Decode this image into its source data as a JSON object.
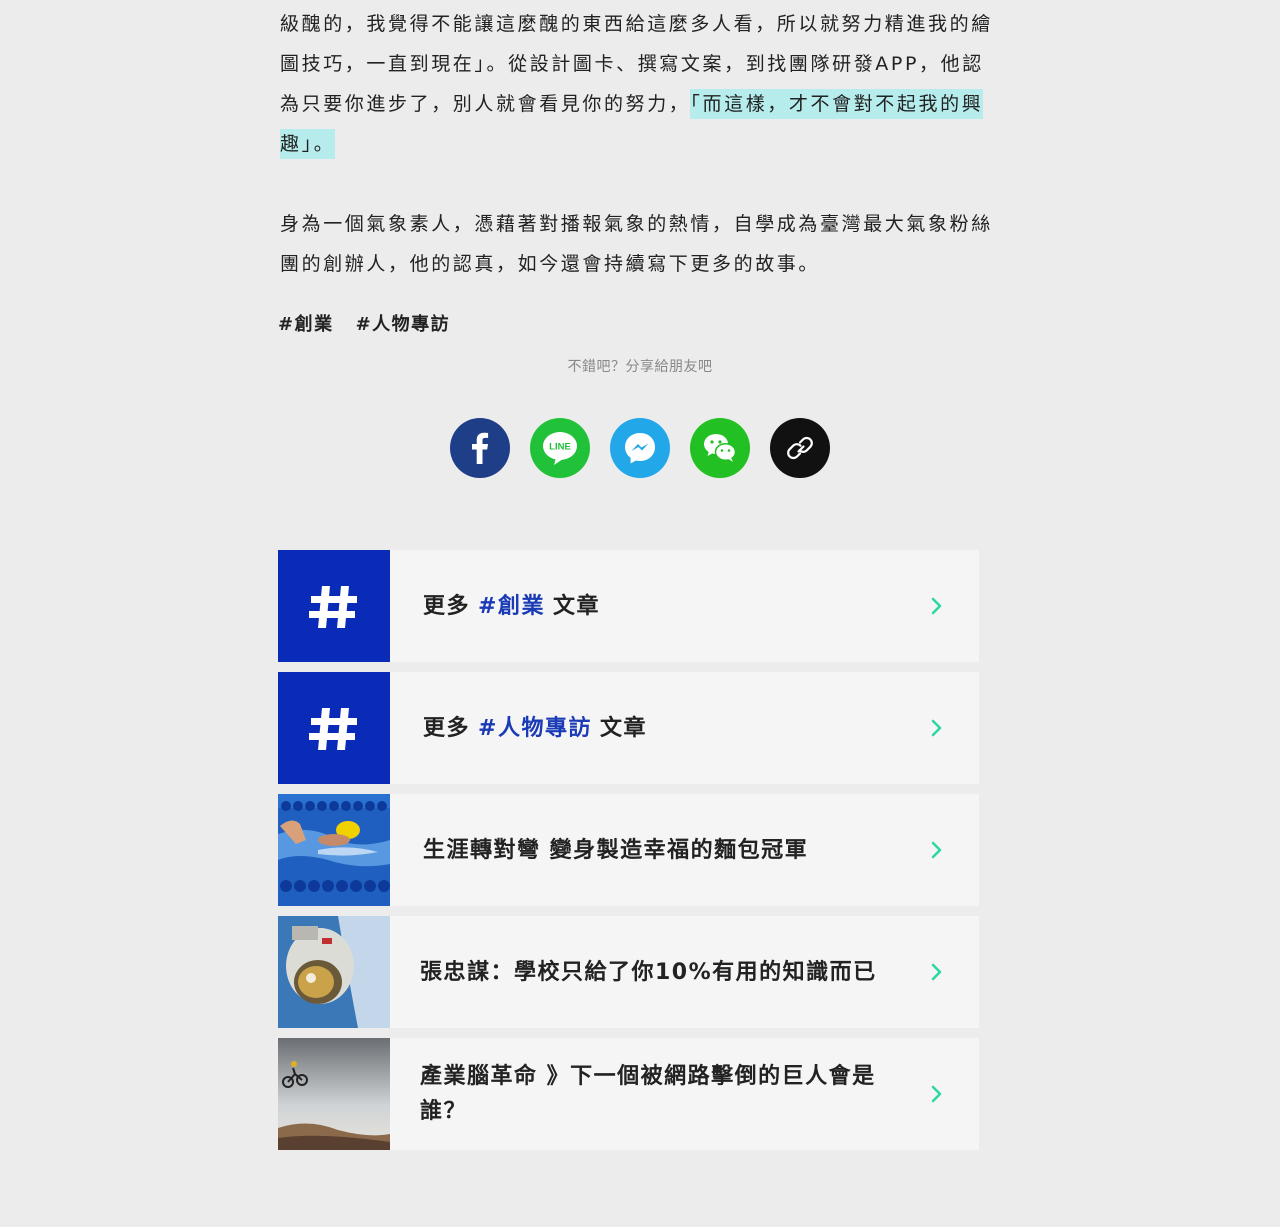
{
  "article": {
    "para1_plain": "級醜的，我覺得不能讓這麼醜的東西給這麼多人看，所以就努力精進我的繪圖技巧，一直到現在」。從設計圖卡、撰寫文案，到找團隊研發APP，他認為只要你進步了，別人就會看見你的努力，",
    "para1_highlight": "「而這樣，才不會對不起我的興趣」。",
    "para2": "身為一個氣象素人，憑藉著對播報氣象的熱情，自學成為臺灣最大氣象粉絲團的創辦人，他的認真，如今還會持續寫下更多的故事。"
  },
  "tags": [
    "#創業",
    "#人物專訪"
  ],
  "share": {
    "label": "不錯吧？分享給朋友吧",
    "line_text": "LINE",
    "buttons": [
      {
        "name": "facebook",
        "color": "#1f3e88"
      },
      {
        "name": "line",
        "color": "#22c13a"
      },
      {
        "name": "messenger",
        "color": "#22a7e8"
      },
      {
        "name": "wechat",
        "color": "#22c022"
      },
      {
        "name": "copy-link",
        "color": "#111111"
      }
    ]
  },
  "more": {
    "prefix": "更多",
    "suffix": "文章",
    "tag1": "#創業",
    "tag2": "#人物專訪"
  },
  "related": [
    {
      "title": "生涯轉對彎 變身製造幸福的麵包冠軍"
    },
    {
      "title": "張忠謀：學校只給了你10%有用的知識而已"
    },
    {
      "title": "產業腦革命 》下一個被網路擊倒的巨人會是誰？"
    }
  ],
  "colors": {
    "accent_blue": "#0a2bb8",
    "chevron_green": "#2fd6a3",
    "highlight": "#b6ecec"
  }
}
